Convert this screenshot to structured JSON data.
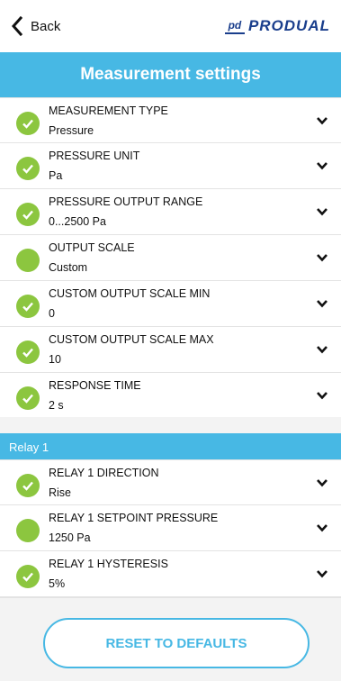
{
  "topbar": {
    "back_label": "Back",
    "brand_mark": "pd",
    "brand": "PRODUAL"
  },
  "header": {
    "title": "Measurement settings"
  },
  "settings": [
    {
      "label": "MEASUREMENT TYPE",
      "value": "Pressure",
      "status": "valid"
    },
    {
      "label": "PRESSURE UNIT",
      "value": "Pa",
      "status": "valid"
    },
    {
      "label": "PRESSURE OUTPUT RANGE",
      "value": "0...2500 Pa",
      "status": "valid"
    },
    {
      "label": "OUTPUT SCALE",
      "value": "Custom",
      "status": "set"
    },
    {
      "label": "CUSTOM OUTPUT SCALE MIN",
      "value": "0",
      "status": "valid"
    },
    {
      "label": "CUSTOM OUTPUT SCALE MAX",
      "value": "10",
      "status": "valid"
    },
    {
      "label": "RESPONSE TIME",
      "value": "2 s",
      "status": "valid"
    }
  ],
  "relay_section": {
    "title": "Relay 1"
  },
  "relay_settings": [
    {
      "label": "RELAY 1 DIRECTION",
      "value": "Rise",
      "status": "valid"
    },
    {
      "label": "RELAY 1 SETPOINT PRESSURE",
      "value": "1250 Pa",
      "status": "set"
    },
    {
      "label": "RELAY 1 HYSTERESIS",
      "value": "5%",
      "status": "valid"
    }
  ],
  "footer": {
    "reset_label": "RESET TO DEFAULTS"
  },
  "colors": {
    "accent": "#47b8e4",
    "status_green": "#8cc63f",
    "brand": "#1a3e8c"
  }
}
